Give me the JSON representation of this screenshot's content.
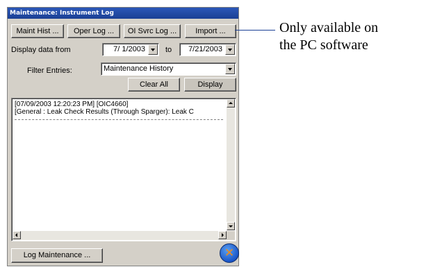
{
  "window": {
    "title": "Maintenance: Instrument Log"
  },
  "toolbar": {
    "maint_hist_label": "Maint Hist ...",
    "oper_log_label": "Oper Log ...",
    "oi_svrc_log_label": "OI Svrc Log ...",
    "import_label": "Import ..."
  },
  "date_range": {
    "label": "Display data from",
    "from_value": "7/ 1/2003",
    "to_label": "to",
    "to_value": "7/21/2003"
  },
  "filter": {
    "label": "Filter Entries:",
    "selected": "Maintenance History"
  },
  "actions": {
    "clear_all_label": "Clear All",
    "display_label": "Display"
  },
  "log": {
    "entries": [
      {
        "line1": "[07/09/2003 12:20:23 PM] [OIC4660]",
        "line2": "[General : Leak Check Results (Through Sparger): Leak C"
      }
    ]
  },
  "footer": {
    "log_maintenance_label": "Log Maintenance ...",
    "close_icon": "close-icon"
  },
  "callout": {
    "line1": "Only available on",
    "line2": "the PC software"
  },
  "colors": {
    "titlebar": "#1a3f94",
    "window_bg": "#d4d0c8",
    "close_button": "#1b56c8",
    "close_x": "#f08a1a"
  }
}
